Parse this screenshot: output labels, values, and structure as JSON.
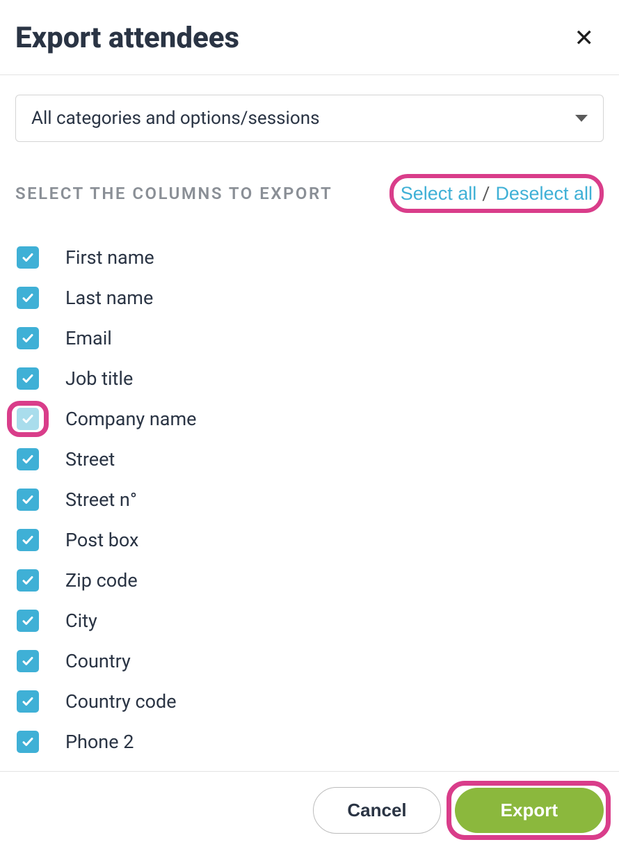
{
  "header": {
    "title": "Export attendees",
    "close": "✕"
  },
  "dropdown": {
    "selected": "All categories and options/sessions"
  },
  "section": {
    "label": "SELECT THE COLUMNS TO EXPORT",
    "select_all": "Select all",
    "divider": "/",
    "deselect_all": "Deselect all"
  },
  "columns": [
    {
      "label": "First name",
      "checked": true,
      "highlighted": false
    },
    {
      "label": "Last name",
      "checked": true,
      "highlighted": false
    },
    {
      "label": "Email",
      "checked": true,
      "highlighted": false
    },
    {
      "label": "Job title",
      "checked": true,
      "highlighted": false
    },
    {
      "label": "Company name",
      "checked": true,
      "highlighted": true
    },
    {
      "label": "Street",
      "checked": true,
      "highlighted": false
    },
    {
      "label": "Street n°",
      "checked": true,
      "highlighted": false
    },
    {
      "label": "Post box",
      "checked": true,
      "highlighted": false
    },
    {
      "label": "Zip code",
      "checked": true,
      "highlighted": false
    },
    {
      "label": "City",
      "checked": true,
      "highlighted": false
    },
    {
      "label": "Country",
      "checked": true,
      "highlighted": false
    },
    {
      "label": "Country code",
      "checked": true,
      "highlighted": false
    },
    {
      "label": "Phone 2",
      "checked": true,
      "highlighted": false
    }
  ],
  "footer": {
    "cancel": "Cancel",
    "export": "Export"
  }
}
